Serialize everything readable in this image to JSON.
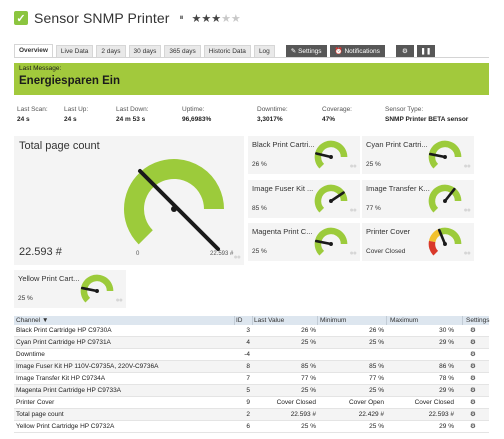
{
  "header": {
    "title": "Sensor SNMP Printer",
    "pause_icon": "pause-icon",
    "check_icon": "check-icon",
    "stars_on": "★★★",
    "stars_off": "★★"
  },
  "tabs": [
    {
      "label": "Overview",
      "active": true
    },
    {
      "label": "Live Data"
    },
    {
      "label": "2 days"
    },
    {
      "label": "30 days"
    },
    {
      "label": "365 days"
    },
    {
      "label": "Historic Data"
    },
    {
      "label": "Log"
    },
    {
      "label": "Settings",
      "icon": "wrench-icon"
    },
    {
      "label": "Notifications",
      "icon": "alarm-icon"
    },
    {
      "label": "",
      "icon": "gear-icon"
    },
    {
      "label": "",
      "icon": "pause-icon"
    }
  ],
  "message": {
    "label": "Last Message:",
    "text": "Energiesparen Ein"
  },
  "stats": {
    "last_scan": {
      "label": "Last Scan:",
      "value": "24 s"
    },
    "last_up": {
      "label": "Last Up:",
      "value": "24 s"
    },
    "last_down": {
      "label": "Last Down:",
      "value": "24 m 53 s"
    },
    "uptime": {
      "label": "Uptime:",
      "value": "96,6983%"
    },
    "downtime": {
      "label": "Downtime:",
      "value": "3,3017%"
    },
    "coverage": {
      "label": "Coverage:",
      "value": "47%"
    },
    "sensor_type": {
      "label": "Sensor Type:",
      "value": "SNMP Printer BETA sensor"
    }
  },
  "big_gauge": {
    "title": "Total page count",
    "value_text": "22.593 #",
    "min_text": "0",
    "max_text": "22.593 #",
    "fraction": 1.0,
    "color": "#9ccb3b"
  },
  "small_gauges": [
    {
      "title": "Black Print Cartri...",
      "value_text": "26 %",
      "fraction": 0.26
    },
    {
      "title": "Cyan Print Cartri...",
      "value_text": "25 %",
      "fraction": 0.25
    },
    {
      "title": "Image Fuser Kit ...",
      "value_text": "85 %",
      "fraction": 0.85
    },
    {
      "title": "Image Transfer K...",
      "value_text": "77 %",
      "fraction": 0.77
    },
    {
      "title": "Magenta Print C...",
      "value_text": "25 %",
      "fraction": 0.25
    },
    {
      "title": "Printer Cover",
      "value_text": "Cover Closed",
      "fraction": 0.5,
      "lookup": true
    },
    {
      "title": "Yellow Print Cart...",
      "value_text": "25 %",
      "fraction": 0.25
    }
  ],
  "table": {
    "headers": {
      "channel": "Channel",
      "id": "ID",
      "last": "Last Value",
      "min": "Minimum",
      "max": "Maximum",
      "settings": "Settings"
    },
    "rows": [
      {
        "name": "Black Print Cartridge HP C9730A",
        "id": "3",
        "last": "26 %",
        "min": "26 %",
        "max": "30 %"
      },
      {
        "name": "Cyan Print Cartridge HP C9731A",
        "id": "4",
        "last": "25 %",
        "min": "25 %",
        "max": "29 %"
      },
      {
        "name": "Downtime",
        "id": "-4",
        "last": "",
        "min": "",
        "max": ""
      },
      {
        "name": "Image Fuser Kit HP 110V-C9735A, 220V-C9736A",
        "id": "8",
        "last": "85 %",
        "min": "85 %",
        "max": "86 %"
      },
      {
        "name": "Image Transfer Kit HP C9734A",
        "id": "7",
        "last": "77 %",
        "min": "77 %",
        "max": "78 %"
      },
      {
        "name": "Magenta Print Cartridge HP C9733A",
        "id": "5",
        "last": "25 %",
        "min": "25 %",
        "max": "29 %"
      },
      {
        "name": "Printer Cover",
        "id": "9",
        "last": "Cover Closed",
        "min": "Cover Open",
        "max": "Cover Closed"
      },
      {
        "name": "Total page count",
        "id": "2",
        "last": "22.593 #",
        "min": "22.429 #",
        "max": "22.593 #"
      },
      {
        "name": "Yellow Print Cartridge HP C9732A",
        "id": "6",
        "last": "25 %",
        "min": "25 %",
        "max": "29 %"
      }
    ]
  },
  "colors": {
    "accent_green": "#9ccb3b",
    "message_bg": "#a2c93c",
    "table_head": "#dde6ef"
  }
}
